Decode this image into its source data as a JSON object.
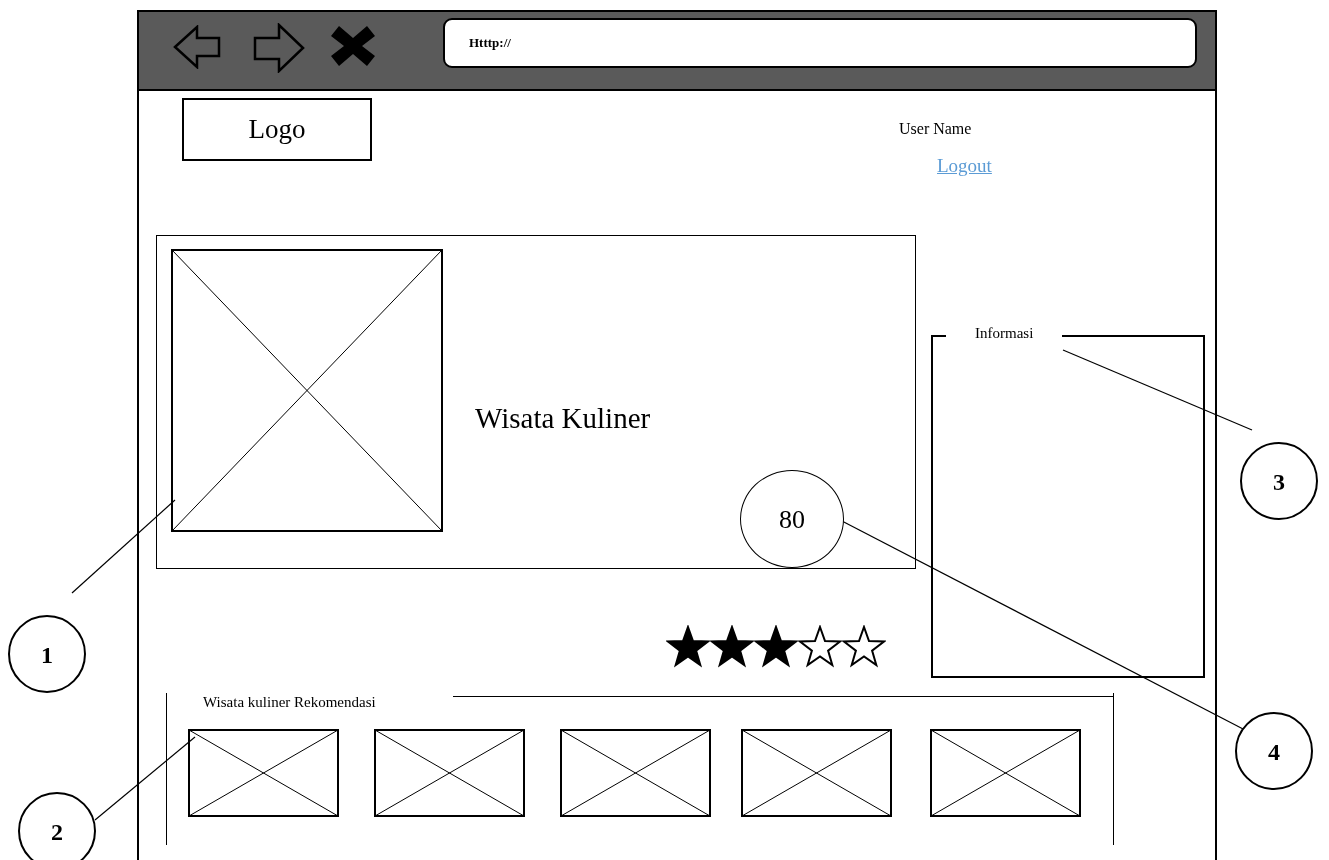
{
  "browser": {
    "address": "Htttp://"
  },
  "header": {
    "logo": "Logo",
    "user_name": "User Name",
    "logout": "Logout"
  },
  "featured": {
    "title": "Wisata Kuliner",
    "score": "80",
    "stars": 3
  },
  "info_panel": {
    "title": "Informasi"
  },
  "recommendations": {
    "title": "Wisata kuliner Rekomendasi",
    "items": [
      {
        "kind": "image-placeholder"
      },
      {
        "kind": "image-placeholder"
      },
      {
        "kind": "image-placeholder"
      },
      {
        "kind": "image-placeholder"
      },
      {
        "kind": "image-placeholder"
      }
    ]
  },
  "callouts": [
    {
      "label": "1"
    },
    {
      "label": "2"
    },
    {
      "label": "3"
    },
    {
      "label": "4"
    }
  ]
}
